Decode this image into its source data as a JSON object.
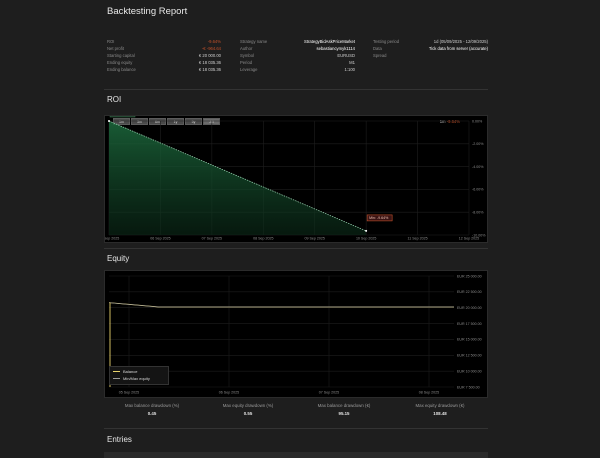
{
  "report": {
    "title": "Backtesting Report"
  },
  "info": {
    "col1": [
      {
        "label": "ROI",
        "value": "-9.64%",
        "color": "#c0502a"
      },
      {
        "label": "Net profit",
        "value": "-€ -964.64",
        "color": "#c0502a"
      },
      {
        "label": "Starting capital",
        "value": "€ 20 000.00",
        "color": "#cfcfcf"
      },
      {
        "label": "Ending equity",
        "value": "€ 18 035.36",
        "color": "#cfcfcf"
      },
      {
        "label": "Ending balance",
        "value": "€ 18 035.36",
        "color": "#cfcfcf"
      }
    ],
    "col2": [
      {
        "label": "Strategy name",
        "value": "StrategyBidAskPriceMarket",
        "color": "#ffffff"
      },
      {
        "label": "Author",
        "value": "sebastiancymyk1114",
        "color": "#ffffff"
      },
      {
        "label": "Symbol",
        "value": "EURUSD",
        "color": "#cfcfcf"
      },
      {
        "label": "Period",
        "value": "M1",
        "color": "#cfcfcf"
      },
      {
        "label": "Leverage",
        "value": "1:100",
        "color": "#cfcfcf"
      }
    ],
    "col3": [
      {
        "label": "Testing period",
        "value": "1d (05/09/2025 - 12/09/2025)",
        "color": "#cfcfcf"
      },
      {
        "label": "Data",
        "value": "Tick data from server (accurate)",
        "color": "#ffffff"
      },
      {
        "label": "Spread",
        "value": "",
        "color": "#cfcfcf"
      }
    ]
  },
  "roi": {
    "section_title": "ROI",
    "range_buttons": [
      "1m",
      "3m",
      "6m",
      "1y",
      "5y",
      "All"
    ],
    "active_button": "All",
    "current_label": "1m",
    "current_value": "-9.64%",
    "start_badge": "Max: 0.00%",
    "end_badge": "Min: -9.64%",
    "accent_color": "#c0502a",
    "y_axis_labels": [
      "0.00%",
      "-2.00%",
      "-4.00%",
      "-6.00%",
      "-8.00%",
      "-10.00%"
    ],
    "x_axis_labels": [
      "05 Sep 2025",
      "06 Sep 2025",
      "07 Sep 2025",
      "08 Sep 2025",
      "09 Sep 2025",
      "10 Sep 2025",
      "11 Sep 2025",
      "12 Sep 2025"
    ]
  },
  "chart_data": [
    {
      "type": "area",
      "title": "ROI",
      "x": [
        "05 Sep 2025",
        "10 Sep 2025"
      ],
      "series": [
        {
          "name": "",
          "values": [
            0.0,
            -9.64
          ]
        }
      ],
      "ylim": [
        -10,
        0
      ],
      "grid": true
    },
    {
      "type": "line",
      "title": "Equity",
      "x": [
        "05 Sep 2025",
        "06 Sep 2025",
        "07 Sep 2025",
        "08 Sep 2025",
        "09 Sep 2025",
        "10 Sep 2025",
        "11 Sep 2025",
        "12 Sep 2025"
      ],
      "series": [
        {
          "name": "Balance",
          "values": [
            19000,
            18035,
            18035,
            18035,
            18035,
            18035,
            18035,
            18035
          ]
        },
        {
          "name": "Min/Max equity",
          "values": [
            19000,
            18035,
            18035,
            18035,
            18035,
            18035,
            18035,
            18035
          ]
        }
      ],
      "ylim": [
        0,
        25000
      ],
      "grid": true,
      "legend": "bottom-left"
    }
  ],
  "equity": {
    "section_title": "Equity",
    "y_axis_labels": [
      "EUR 25 000.00",
      "EUR 22 500.00",
      "EUR 20 000.00",
      "EUR 17 500.00",
      "EUR 15 000.00",
      "EUR 12 500.00",
      "EUR 10 000.00",
      "EUR 7 500.00"
    ],
    "x_axis_labels": [
      "05 Sep 2025",
      "06 Sep 2025",
      "07 Sep 2025",
      "08 Sep 2025"
    ],
    "legend": [
      {
        "label": "Balance",
        "color": "#e8d36a"
      },
      {
        "label": "Min/Max equity",
        "color": "#9a9a9a"
      }
    ]
  },
  "drawdowns": [
    {
      "label": "Max balance drawdown (%)",
      "value": "0.45"
    },
    {
      "label": "Max equity drawdown (%)",
      "value": "0.55"
    },
    {
      "label": "Max balance drawdown (€)",
      "value": "95.15"
    },
    {
      "label": "Max equity drawdown (€)",
      "value": "108.48"
    }
  ],
  "entries": {
    "section_title": "Entries"
  }
}
